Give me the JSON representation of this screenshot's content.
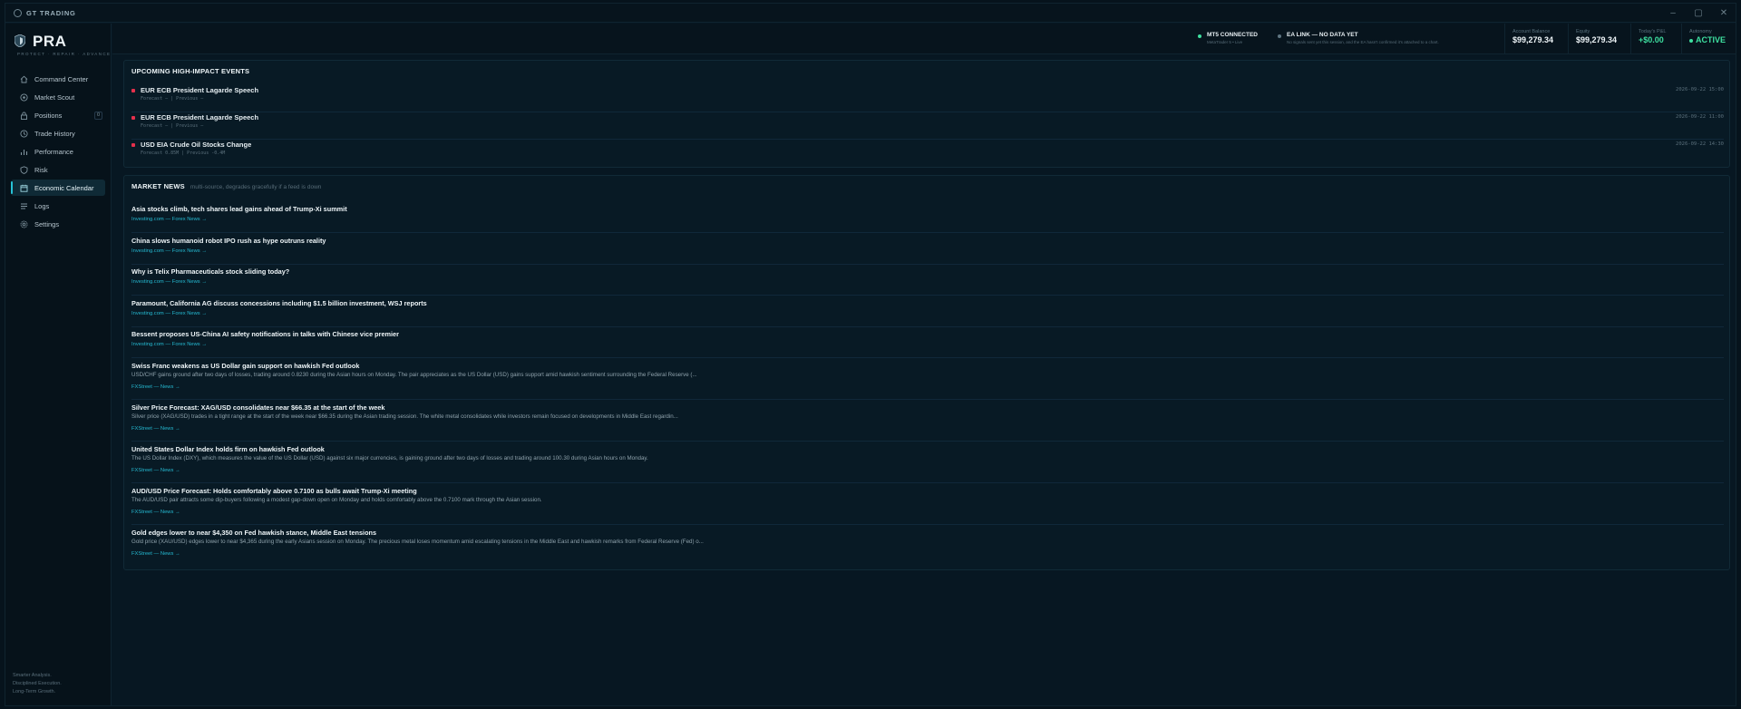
{
  "window": {
    "title": "GT TRADING"
  },
  "brand": {
    "name": "PRA",
    "tagline": "PROTECT · REPAIR · ADVANCE"
  },
  "sidebar": {
    "items": [
      {
        "label": "Command Center",
        "icon": "home-icon"
      },
      {
        "label": "Market Scout",
        "icon": "target-icon"
      },
      {
        "label": "Positions",
        "icon": "lock-icon",
        "badge": "0"
      },
      {
        "label": "Trade History",
        "icon": "clock-icon"
      },
      {
        "label": "Performance",
        "icon": "bar-chart-icon"
      },
      {
        "label": "Risk",
        "icon": "shield-icon"
      },
      {
        "label": "Economic Calendar",
        "icon": "calendar-icon",
        "active": true
      },
      {
        "label": "Logs",
        "icon": "list-icon"
      },
      {
        "label": "Settings",
        "icon": "gear-icon"
      }
    ],
    "footer": [
      "Smarter Analysis.",
      "Disciplined Execution.",
      "Long-Term Growth."
    ]
  },
  "status": {
    "mt5": {
      "title": "MT5 CONNECTED",
      "sub": "MetaTrader 5 • Live",
      "color": "#3ee0a0"
    },
    "ea": {
      "title": "EA LINK — NO DATA YET",
      "sub": "No signals sent yet this session, and the EA hasn't confirmed it's attached to a chart.",
      "color": "#5f7581"
    },
    "balance": {
      "label": "Account Balance",
      "value": "$99,279.34"
    },
    "equity": {
      "label": "Equity",
      "value": "$99,279.34"
    },
    "pnl": {
      "label": "Today's P&L",
      "value": "+$0.00"
    },
    "autonomy": {
      "label": "Autonomy",
      "value": "ACTIVE"
    }
  },
  "events": {
    "title": "UPCOMING HIGH-IMPACT EVENTS",
    "items": [
      {
        "title": "EUR ECB President Lagarde Speech",
        "meta": "Forecast —  |  Previous —",
        "time": "2026-09-22 15:00"
      },
      {
        "title": "EUR ECB President Lagarde Speech",
        "meta": "Forecast —  |  Previous —",
        "time": "2026-09-22 11:00"
      },
      {
        "title": "USD EIA Crude Oil Stocks Change",
        "meta": "Forecast 0.85M  |  Previous -0.4M",
        "time": "2026-09-22 14:30"
      }
    ]
  },
  "news": {
    "title": "MARKET NEWS",
    "subtitle": "multi-source, degrades gracefully if a feed is down",
    "items": [
      {
        "title": "Asia stocks climb, tech shares lead gains ahead of Trump-Xi summit",
        "desc": "",
        "source": "Investing.com — Forex News →"
      },
      {
        "title": "China slows humanoid robot IPO rush as hype outruns reality",
        "desc": "",
        "source": "Investing.com — Forex News →"
      },
      {
        "title": "Why is Telix Pharmaceuticals stock sliding today?",
        "desc": "",
        "source": "Investing.com — Forex News →"
      },
      {
        "title": "Paramount, California AG discuss concessions including $1.5 billion investment, WSJ reports",
        "desc": "",
        "source": "Investing.com — Forex News →"
      },
      {
        "title": "Bessent proposes US-China AI safety notifications in talks with Chinese vice premier",
        "desc": "",
        "source": "Investing.com — Forex News →"
      },
      {
        "title": "Swiss Franc weakens as US Dollar gain support on hawkish Fed outlook",
        "desc": "USD/CHF gains ground after two days of losses, trading around 0.8230 during the Asian hours on Monday. The pair appreciates as the US Dollar (USD) gains support amid hawkish sentiment surrounding the Federal Reserve (...",
        "source": "FXStreet — News →"
      },
      {
        "title": "Silver Price Forecast: XAG/USD consolidates near $66.35 at the start of the week",
        "desc": "Silver price (XAG/USD) trades in a tight range at the start of the week near $66.35 during the Asian trading session. The white metal consolidates while investors remain focused on developments in Middle East regardin...",
        "source": "FXStreet — News →"
      },
      {
        "title": "United States Dollar Index holds firm on hawkish Fed outlook",
        "desc": "The US Dollar Index (DXY), which measures the value of the US Dollar (USD) against six major currencies, is gaining ground after two days of losses and trading around 100.30 during Asian hours on Monday.",
        "source": "FXStreet — News →"
      },
      {
        "title": "AUD/USD Price Forecast: Holds comfortably above 0.7100 as bulls await Trump-Xi meeting",
        "desc": "The AUD/USD pair attracts some dip-buyers following a modest gap-down open on Monday and holds comfortably above the 0.7100 mark through the Asian session.",
        "source": "FXStreet — News →"
      },
      {
        "title": "Gold edges lower to near $4,350 on Fed hawkish stance, Middle East tensions",
        "desc": "Gold price (XAU/USD) edges lower to near $4,365 during the early Asians session on Monday. The precious metal loses momentum amid escalating tensions in the Middle East and hawkish remarks from Federal Reserve (Fed) o...",
        "source": "FXStreet — News →"
      }
    ]
  },
  "colors": {
    "accent": "#27c2d6",
    "positive": "#3ee0a0",
    "impact_high": "#e5304c"
  }
}
